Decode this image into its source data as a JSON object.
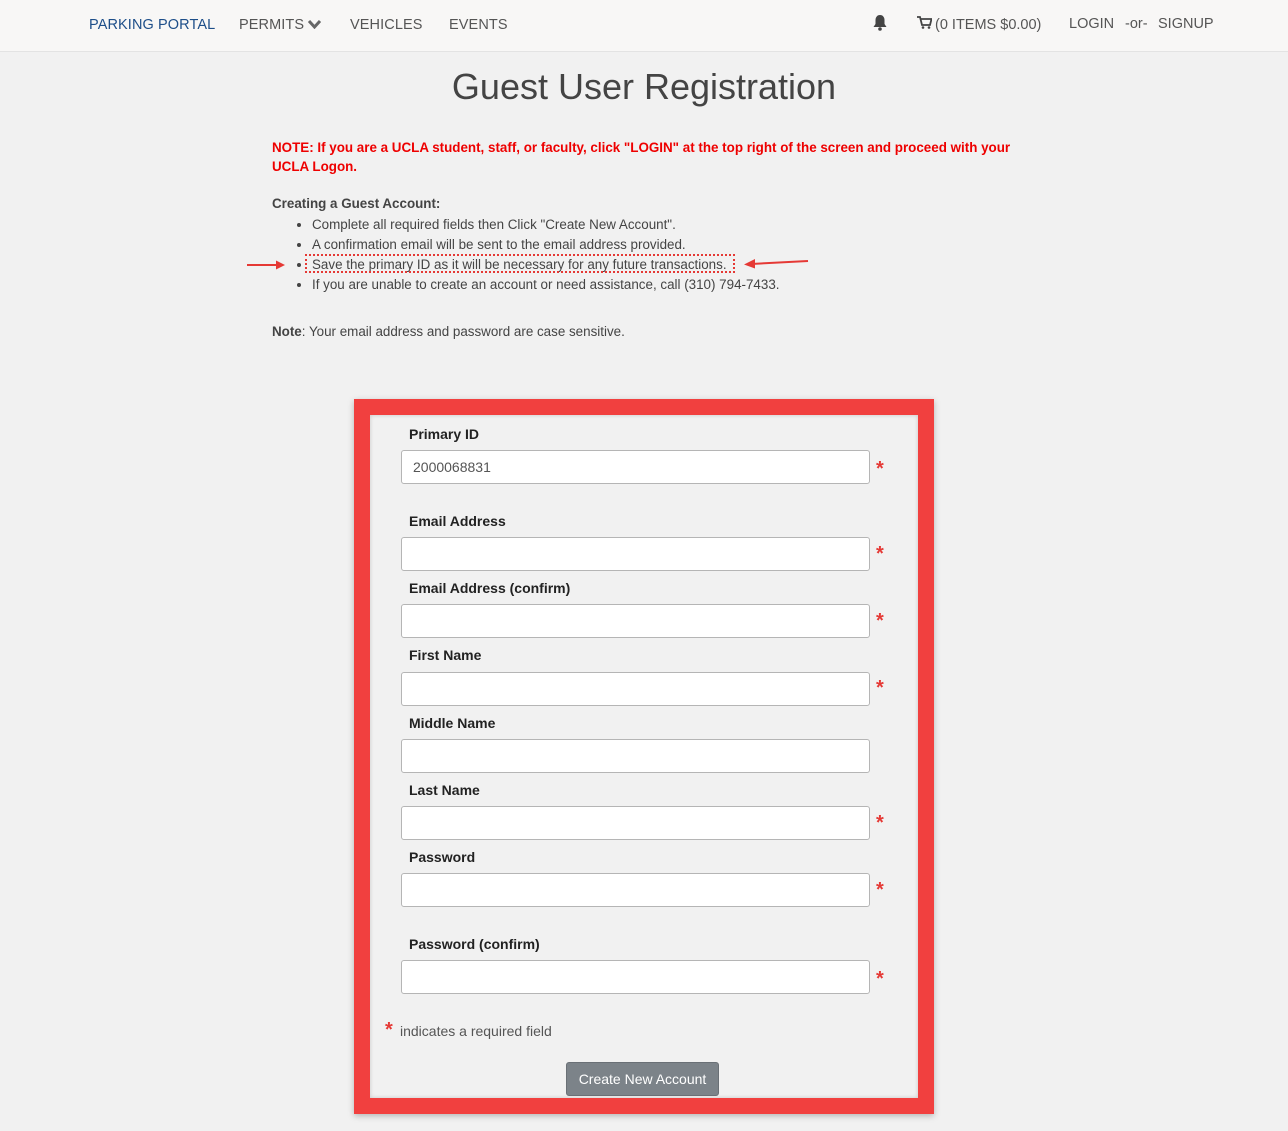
{
  "nav": {
    "brand": "PARKING PORTAL",
    "permits": "PERMITS",
    "vehicles": "VEHICLES",
    "events": "EVENTS",
    "cart": "(0 ITEMS $0.00)",
    "login": "LOGIN",
    "or": "-or-",
    "signup": "SIGNUP",
    "icons": [
      "bell-icon",
      "cart-icon",
      "chevron-down-icon"
    ]
  },
  "page": {
    "title": "Guest User Registration",
    "ucla_note": "NOTE: If you are a UCLA student, staff, or faculty, click \"LOGIN\" at the top right of the screen and proceed with your UCLA Logon.",
    "guest_heading": "Creating a Guest Account:",
    "bullets": [
      "Complete all required fields then Click \"Create New Account\".",
      "A confirmation email will be sent to the email address provided.",
      "Save the primary ID as it will be necessary for any future transactions.",
      "If you are unable to create an account or need assistance, call (310) 794-7433."
    ],
    "case_note_label": "Note",
    "case_note_text": ": Your email address and password are case sensitive."
  },
  "form": {
    "fields": [
      {
        "label": "Primary ID",
        "value": "2000068831",
        "required": true
      },
      {
        "label": "Email Address",
        "value": "",
        "required": true
      },
      {
        "label": "Email Address (confirm)",
        "value": "",
        "required": true
      },
      {
        "label": "First Name",
        "value": "",
        "required": true
      },
      {
        "label": "Middle Name",
        "value": "",
        "required": false
      },
      {
        "label": "Last Name",
        "value": "",
        "required": true
      },
      {
        "label": "Password",
        "value": "",
        "required": true
      },
      {
        "label": "Password (confirm)",
        "value": "",
        "required": true
      }
    ],
    "required_star": "*",
    "required_legend": "indicates a required field",
    "submit_label": "Create New Account"
  },
  "colors": {
    "accent_red": "#e53935",
    "highlight_border": "#f1403f",
    "brand_blue": "#1d4e89",
    "button_gray": "#7c8389"
  }
}
